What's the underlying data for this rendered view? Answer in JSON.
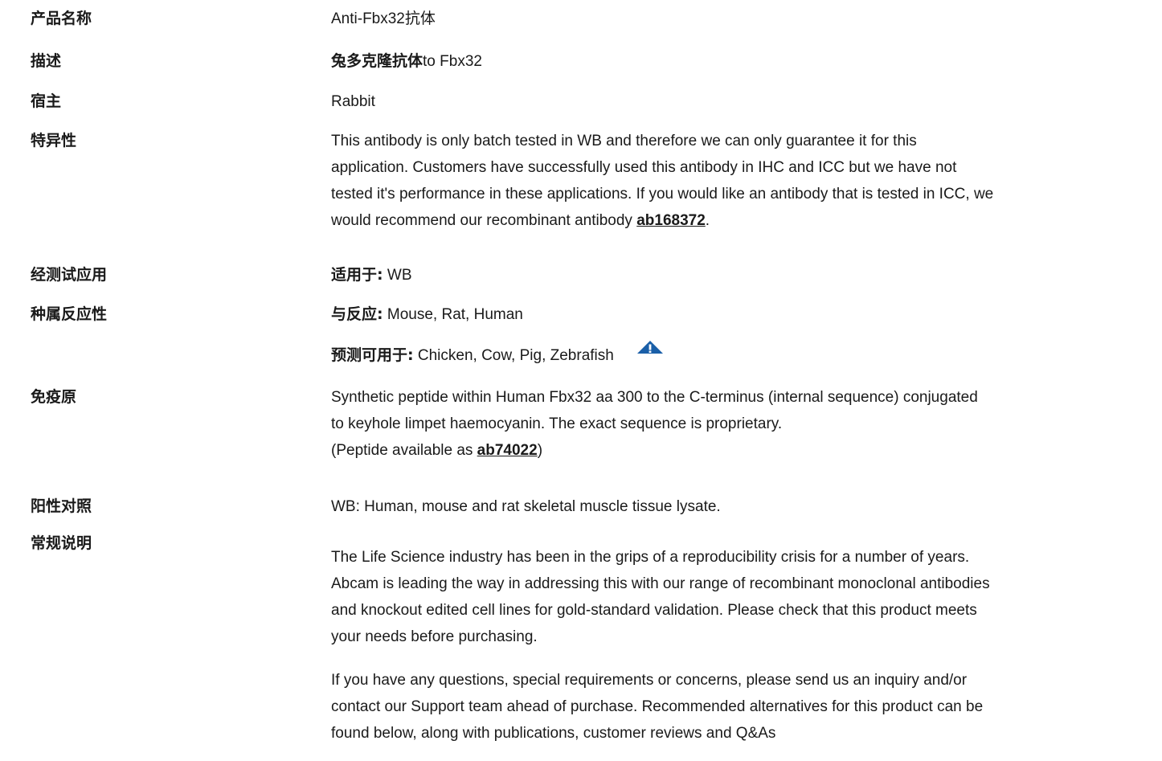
{
  "rows": {
    "product_name": {
      "label": "产品名称",
      "value": "Anti-Fbx32抗体"
    },
    "description": {
      "label": "描述",
      "bold": "兔多克隆抗体",
      "text": "to Fbx32"
    },
    "host": {
      "label": "宿主",
      "value": "Rabbit"
    },
    "specificity": {
      "label": "特异性",
      "lines": [
        "This antibody is only batch tested in WB and therefore we can only guarantee it for this",
        "application. Customers have successfully used this antibody in IHC and ICC but we have not",
        "tested it's performance in these applications. If you would like an antibody that is tested in ICC, we"
      ],
      "last_prefix": "would recommend our recombinant antibody ",
      "link": "ab168372",
      "last_suffix": "."
    },
    "tested_applications": {
      "label": "经测试应用",
      "bold": "适用于:",
      "text": " WB"
    },
    "species_reactivity": {
      "label": "种属反应性",
      "reacts_bold": "与反应:",
      "reacts_text": " Mouse, Rat, Human",
      "predicted_bold": "预测可用于:",
      "predicted_text": " Chicken, Cow, Pig, Zebrafish",
      "warning_icon": "warning-triangle-icon",
      "icon_color": "#1a5fa8"
    },
    "immunogen": {
      "label": "免疫原",
      "lines": [
        "Synthetic peptide within Human Fbx32 aa 300 to the C-terminus (internal sequence) conjugated",
        "to keyhole limpet haemocyanin. The exact sequence is proprietary."
      ],
      "peptide_prefix": "(Peptide available as ",
      "link": "ab74022",
      "peptide_suffix": ")"
    },
    "positive_control": {
      "label": "阳性对照",
      "value": "WB: Human, mouse and rat skeletal muscle tissue lysate."
    },
    "general_notes": {
      "label": "常规说明",
      "para1": [
        "The Life Science industry has been in the grips of a reproducibility crisis for a number of years.",
        "Abcam is leading the way in addressing this with our range of recombinant monoclonal antibodies",
        "and knockout edited cell lines for gold-standard validation. Please check that this product meets",
        "your needs before purchasing."
      ],
      "para2": [
        "If you have any questions, special requirements or concerns, please send us an inquiry and/or",
        "contact our Support team ahead of purchase. Recommended alternatives for this product can be",
        "found below, along with publications, customer reviews and Q&As"
      ]
    }
  }
}
